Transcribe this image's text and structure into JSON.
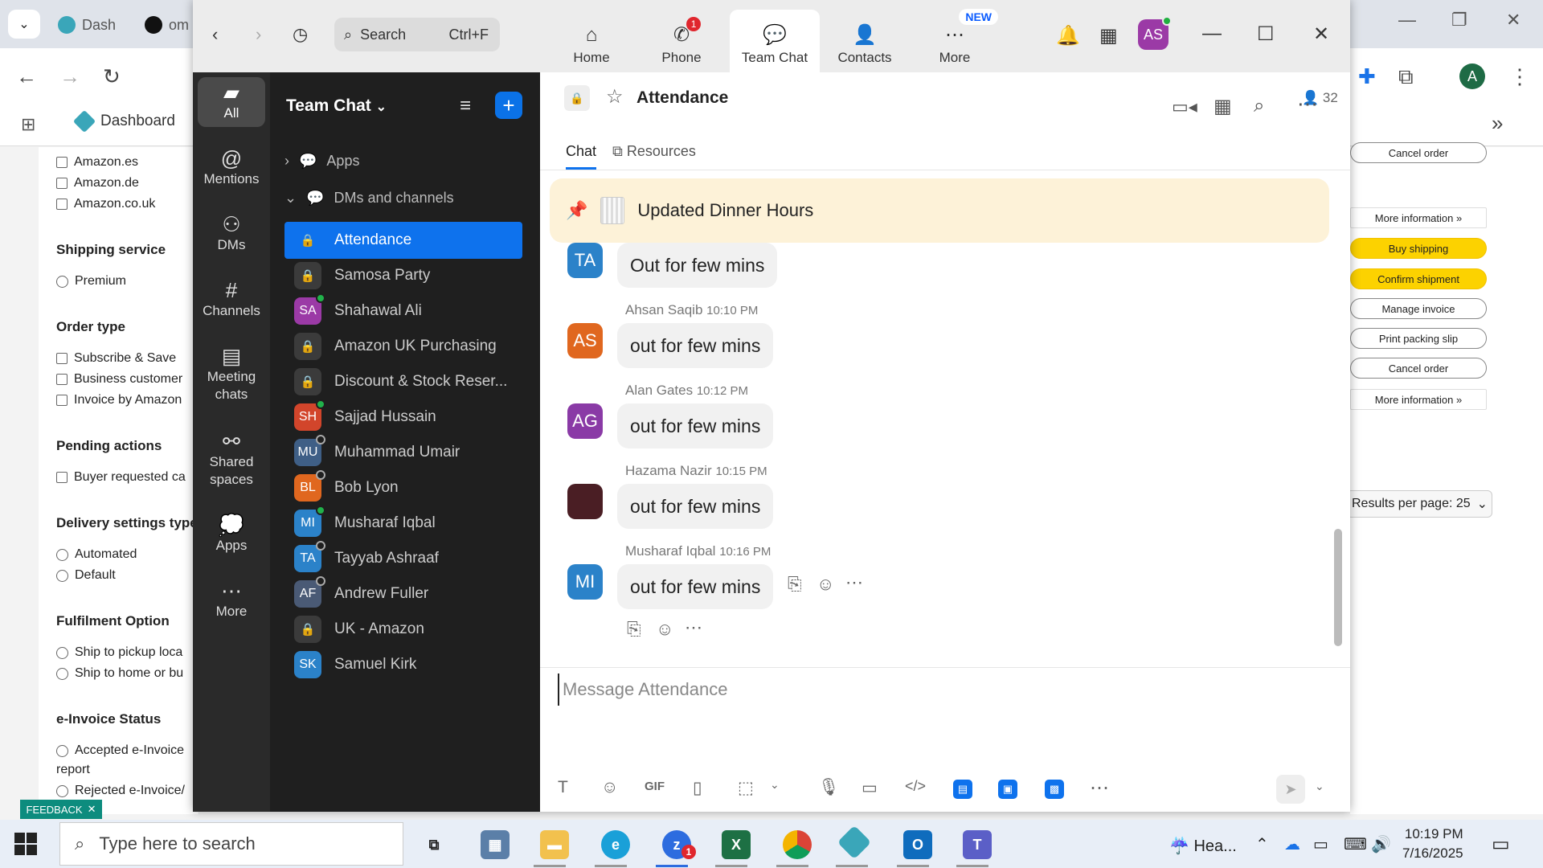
{
  "browser": {
    "tabs": [
      {
        "label": "Dash"
      },
      {
        "label": "om"
      }
    ],
    "bookmark": "Dashboard",
    "avatar_letter": "A"
  },
  "background_page": {
    "checkboxes_top": [
      "Amazon.es",
      "Amazon.de",
      "Amazon.co.uk"
    ],
    "shipping_service": {
      "title": "Shipping service",
      "options": [
        "Premium"
      ]
    },
    "order_type": {
      "title": "Order type",
      "options": [
        "Subscribe & Save",
        "Business customer",
        "Invoice by Amazon"
      ]
    },
    "pending_actions": {
      "title": "Pending actions",
      "options": [
        "Buyer requested ca"
      ]
    },
    "delivery_settings": {
      "title": "Delivery settings type",
      "options": [
        "Automated",
        "Default"
      ]
    },
    "fulfilment": {
      "title": "Fulfilment Option",
      "options": [
        "Ship to pickup loca",
        "Ship to home or bu"
      ]
    },
    "einvoice": {
      "title": "e-Invoice Status",
      "options": [
        "Accepted e-Invoice",
        "report",
        "Rejected e-Invoice/"
      ]
    },
    "feedback": "FEEDBACK",
    "right_buttons": [
      {
        "label": "Cancel order",
        "style": "outline"
      },
      {
        "label": "More information »",
        "style": "more"
      },
      {
        "label": "Buy shipping",
        "style": "yellow"
      },
      {
        "label": "Confirm shipment",
        "style": "yellow"
      },
      {
        "label": "Manage invoice",
        "style": "outline"
      },
      {
        "label": "Print packing slip",
        "style": "outline"
      },
      {
        "label": "Cancel order",
        "style": "outline"
      },
      {
        "label": "More information »",
        "style": "more"
      }
    ],
    "results_per_page": "Results per page: 25"
  },
  "zoom": {
    "search": {
      "placeholder": "Search",
      "shortcut": "Ctrl+F"
    },
    "tabs": {
      "home": "Home",
      "phone": "Phone",
      "phone_badge": "1",
      "team_chat": "Team Chat",
      "contacts": "Contacts",
      "more": "More",
      "more_badge": "NEW"
    },
    "user_initials": "AS",
    "rail": {
      "all": "All",
      "mentions": "Mentions",
      "dms": "DMs",
      "channels": "Channels",
      "meeting_chats": "Meeting chats",
      "shared_spaces": "Shared spaces",
      "apps": "Apps",
      "more": "More"
    },
    "sidebar": {
      "title": "Team Chat",
      "apps_group": "Apps",
      "dms_group": "DMs and channels",
      "items": [
        {
          "label": "Attendance",
          "type": "lock",
          "active": true
        },
        {
          "label": "Samosa Party",
          "type": "lock"
        },
        {
          "label": "Shahawal Ali",
          "initials": "SA",
          "color": "#9b3aa6",
          "status": "on"
        },
        {
          "label": "Amazon UK Purchasing",
          "type": "lock"
        },
        {
          "label": "Discount & Stock Reser...",
          "type": "lock"
        },
        {
          "label": "Sajjad Hussain",
          "initials": "SH",
          "color": "#d2452b",
          "status": "on"
        },
        {
          "label": "Muhammad Umair",
          "initials": "MU",
          "color": "#3f5f86",
          "status": "away"
        },
        {
          "label": "Bob Lyon",
          "initials": "BL",
          "color": "#e0671f",
          "status": "away"
        },
        {
          "label": "Musharaf Iqbal",
          "initials": "MI",
          "color": "#2b82c9",
          "status": "on"
        },
        {
          "label": "Tayyab Ashraaf",
          "initials": "TA",
          "color": "#2b82c9",
          "status": "away"
        },
        {
          "label": "Andrew Fuller",
          "initials": "AF",
          "color": "#4a5a75",
          "status": "away"
        },
        {
          "label": "UK - Amazon",
          "type": "lock"
        },
        {
          "label": "Samuel Kirk",
          "initials": "SK",
          "color": "#2b82c9"
        }
      ]
    },
    "channel": {
      "name": "Attendance",
      "members": "32",
      "tabs": {
        "chat": "Chat",
        "resources": "Resources"
      },
      "pinned": "Updated Dinner Hours",
      "messages": [
        {
          "initials": "TA",
          "color": "#2b82c9",
          "author": "",
          "time": "",
          "text": "Out for few mins"
        },
        {
          "initials": "AS",
          "color": "#e0671f",
          "author": "Ahsan Saqib",
          "time": "10:10 PM",
          "text": "out for few mins"
        },
        {
          "initials": "AG",
          "color": "#8a3aa6",
          "author": "Alan Gates",
          "time": "10:12 PM",
          "text": "out for few mins"
        },
        {
          "initials": "",
          "color": "#4a1e24",
          "author": "Hazama Nazir",
          "time": "10:15 PM",
          "text": "out for few mins"
        },
        {
          "initials": "MI",
          "color": "#2b82c9",
          "author": "Musharaf Iqbal",
          "time": "10:16 PM",
          "text": "out for few mins"
        }
      ],
      "compose_placeholder": "Message Attendance"
    }
  },
  "taskbar": {
    "search_placeholder": "Type here to search",
    "weather": "Hea...",
    "time": "10:19 PM",
    "date": "7/16/2025",
    "zoom_badge": "1"
  }
}
